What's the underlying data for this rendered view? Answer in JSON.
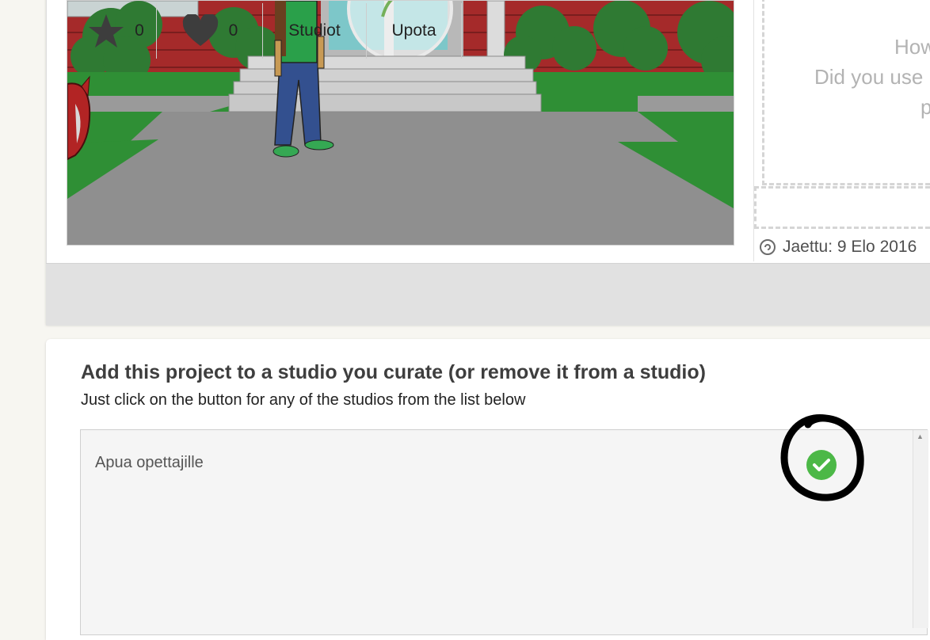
{
  "notes": {
    "line1": "How",
    "line2": "Did you use",
    "line3": "p"
  },
  "shared": {
    "label": "Jaettu: 9 Elo 2016"
  },
  "actions": {
    "stars_count": "0",
    "loves_count": "0",
    "studios_label": "Studiot",
    "embed_label": "Upota"
  },
  "studios": {
    "heading": "Add this project to a studio you curate (or remove it from a studio)",
    "subheading": "Just click on the button for any of the studios from the list below",
    "items": [
      {
        "name": "Apua opettajille",
        "added": true
      }
    ]
  },
  "colors": {
    "check_green": "#4cb847",
    "action_bar": "#e1e1e1",
    "grass": "#2e7d32",
    "path": "#8f8f8f",
    "wall": "#a12a2a"
  },
  "icons": {
    "star": "star-icon",
    "heart": "heart-icon",
    "check": "check-icon",
    "shared": "share-icon"
  }
}
